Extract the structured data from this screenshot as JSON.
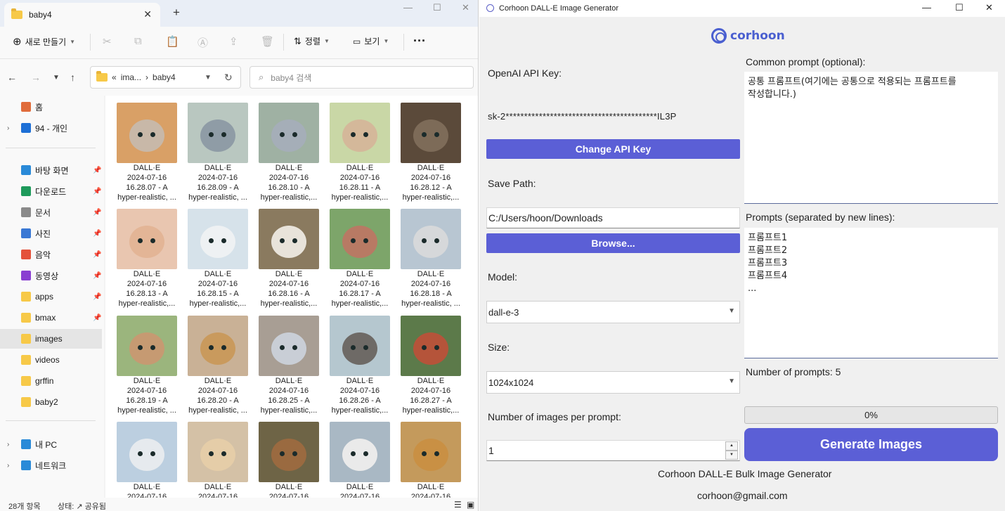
{
  "explorer": {
    "tab_title": "baby4",
    "toolbar": {
      "new_label": "새로 만들기",
      "sort_label": "정렬",
      "view_label": "보기",
      "more": "···"
    },
    "address": {
      "prefix": "«",
      "crumb1": "ima...",
      "sep": "›",
      "crumb2": "baby4"
    },
    "search_placeholder": "baby4 검색",
    "sidebar": [
      {
        "label": "홈",
        "icon": "home-icon",
        "color": "#e06c3b"
      },
      {
        "label": "94 - 개인",
        "icon": "onedrive-icon",
        "color": "#1d6fd6"
      },
      {
        "label": "바탕 화면",
        "icon": "desktop-icon",
        "color": "#2a8ad8"
      },
      {
        "label": "다운로드",
        "icon": "download-icon",
        "color": "#1e9a5b"
      },
      {
        "label": "문서",
        "icon": "document-icon",
        "color": "#8a8a8a"
      },
      {
        "label": "사진",
        "icon": "pictures-icon",
        "color": "#3a78d4"
      },
      {
        "label": "음악",
        "icon": "music-icon",
        "color": "#e4523b"
      },
      {
        "label": "동영상",
        "icon": "video-icon",
        "color": "#8a3fd1"
      },
      {
        "label": "apps",
        "icon": "folder-icon",
        "color": "#f7c948"
      },
      {
        "label": "bmax",
        "icon": "folder-icon",
        "color": "#f7c948"
      },
      {
        "label": "images",
        "icon": "folder-icon",
        "color": "#f7c948"
      },
      {
        "label": "videos",
        "icon": "folder-icon",
        "color": "#f7c948"
      },
      {
        "label": "grffin",
        "icon": "folder-icon",
        "color": "#f7c948"
      },
      {
        "label": "baby2",
        "icon": "folder-icon",
        "color": "#f7c948"
      },
      {
        "label": "내 PC",
        "icon": "pc-icon",
        "color": "#2a8ad8"
      },
      {
        "label": "네트워크",
        "icon": "network-icon",
        "color": "#2a8ad8"
      }
    ],
    "files": [
      {
        "l1": "DALL·E",
        "l2": "2024-07-16",
        "l3": "16.28.07 - A",
        "l4": "hyper-realistic, ...",
        "bg": "#d9a066",
        "face": "#c8b8a8"
      },
      {
        "l1": "DALL·E",
        "l2": "2024-07-16",
        "l3": "16.28.09 - A",
        "l4": "hyper-realistic, ...",
        "bg": "#b9c7c0",
        "face": "#8f9ca6"
      },
      {
        "l1": "DALL·E",
        "l2": "2024-07-16",
        "l3": "16.28.10 - A",
        "l4": "hyper-realistic,...",
        "bg": "#9fb1a3",
        "face": "#a5aeb8"
      },
      {
        "l1": "DALL·E",
        "l2": "2024-07-16",
        "l3": "16.28.11 - A",
        "l4": "hyper-realistic,...",
        "bg": "#c9d7a6",
        "face": "#d4b89a"
      },
      {
        "l1": "DALL·E",
        "l2": "2024-07-16",
        "l3": "16.28.12 - A",
        "l4": "hyper-realistic,...",
        "bg": "#5b4a3a",
        "face": "#7d6b58"
      },
      {
        "l1": "DALL·E",
        "l2": "2024-07-16",
        "l3": "16.28.13 - A",
        "l4": "hyper-realistic,...",
        "bg": "#e9c6b0",
        "face": "#e3b596"
      },
      {
        "l1": "DALL·E",
        "l2": "2024-07-16",
        "l3": "16.28.15 - A",
        "l4": "hyper-realistic,...",
        "bg": "#d6e2ea",
        "face": "#eef1f3"
      },
      {
        "l1": "DALL·E",
        "l2": "2024-07-16",
        "l3": "16.28.16 - A",
        "l4": "hyper-realistic,...",
        "bg": "#8a7a5f",
        "face": "#e8e3da"
      },
      {
        "l1": "DALL·E",
        "l2": "2024-07-16",
        "l3": "16.28.17 - A",
        "l4": "hyper-realistic,...",
        "bg": "#7da56a",
        "face": "#b87a64"
      },
      {
        "l1": "DALL·E",
        "l2": "2024-07-16",
        "l3": "16.28.18 - A",
        "l4": "hyper-realistic, ...",
        "bg": "#b8c6d2",
        "face": "#d6d8da"
      },
      {
        "l1": "DALL·E",
        "l2": "2024-07-16",
        "l3": "16.28.19 - A",
        "l4": "hyper-realistic, ...",
        "bg": "#9bb57d",
        "face": "#c69a72"
      },
      {
        "l1": "DALL·E",
        "l2": "2024-07-16",
        "l3": "16.28.20 - A",
        "l4": "hyper-realistic, ...",
        "bg": "#c9b196",
        "face": "#c99a5d"
      },
      {
        "l1": "DALL·E",
        "l2": "2024-07-16",
        "l3": "16.28.25 - A",
        "l4": "hyper-realistic,...",
        "bg": "#a89e94",
        "face": "#c9ced6"
      },
      {
        "l1": "DALL·E",
        "l2": "2024-07-16",
        "l3": "16.28.26 - A",
        "l4": "hyper-realistic,...",
        "bg": "#b5c7cf",
        "face": "#6e6a66"
      },
      {
        "l1": "DALL·E",
        "l2": "2024-07-16",
        "l3": "16.28.27 - A",
        "l4": "hyper-realistic,...",
        "bg": "#5c7a4a",
        "face": "#b5543a"
      },
      {
        "l1": "DALL·E",
        "l2": "2024-07-16",
        "l3": "",
        "l4": "",
        "bg": "#bccfe0",
        "face": "#e6eaee"
      },
      {
        "l1": "DALL·E",
        "l2": "2024-07-16",
        "l3": "",
        "l4": "",
        "bg": "#d4c1a6",
        "face": "#e5cda8"
      },
      {
        "l1": "DALL·E",
        "l2": "2024-07-16",
        "l3": "",
        "l4": "",
        "bg": "#6e6446",
        "face": "#9a6a40"
      },
      {
        "l1": "DALL·E",
        "l2": "2024-07-16",
        "l3": "",
        "l4": "",
        "bg": "#a9b8c4",
        "face": "#eaeaea"
      },
      {
        "l1": "DALL·E",
        "l2": "2024-07-16",
        "l3": "",
        "l4": "",
        "bg": "#c49a5c",
        "face": "#c99044"
      }
    ],
    "status": {
      "count": "28개 항목",
      "share": "상태: ↗ 공유됨"
    }
  },
  "generator": {
    "title": "Corhoon DALL-E Image Generator",
    "brand": "corhoon",
    "api_label": "OpenAI API Key:",
    "api_value": "sk-2*****************************************IL3P",
    "change_api_button": "Change API Key",
    "save_path_label": "Save Path:",
    "save_path_value": "C:/Users/hoon/Downloads",
    "browse_button": "Browse...",
    "model_label": "Model:",
    "model_value": "dall-e-3",
    "size_label": "Size:",
    "size_value": "1024x1024",
    "num_images_label": "Number of images per prompt:",
    "num_images_value": "1",
    "common_prompt_label": "Common prompt (optional):",
    "common_prompt_value": "공통 프롬프트(여기에는 공통으로 적용되는 프롬프트를\n작성합니다.)",
    "prompts_label": "Prompts (separated by new lines):",
    "prompts_value": "프롬프트1\n프롬프트2\n프롬프트3\n프롬프트4\n...",
    "num_prompts_label": "Number of prompts: 5",
    "progress_text": "0%",
    "progress_fraction": 0,
    "generate_button": "Generate Images",
    "footer_line1": "Corhoon DALL-E Bulk Image Generator",
    "footer_line2": "corhoon@gmail.com"
  }
}
